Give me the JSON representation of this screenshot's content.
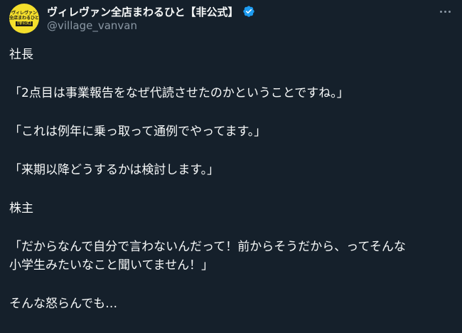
{
  "header": {
    "avatar_text_lines": [
      "ヴィレヴァン",
      "全店まわるひと",
      "[非公式]"
    ],
    "display_name": "ヴィレヴァン全店まわるひと【非公式】",
    "handle": "@village_vanvan",
    "verified_color": "#1d9bf0"
  },
  "tweet": {
    "lines": [
      "社長",
      "「2点目は事業報告をなぜ代読させたのかということですね。」",
      "「これは例年に乗っ取って通例でやってます。」",
      "「来期以降どうするかは検討します。」",
      "株主",
      "「だからなんで自分で言わないんだって！前からそうだから、ってそんな",
      "小学生みたいなこと聞いてません！」",
      "そんな怒らんでも…"
    ]
  },
  "colors": {
    "background": "#15202b",
    "text": "#f7f9f9",
    "secondary_text": "#8b98a5",
    "avatar_bg": "#f4df2c"
  }
}
